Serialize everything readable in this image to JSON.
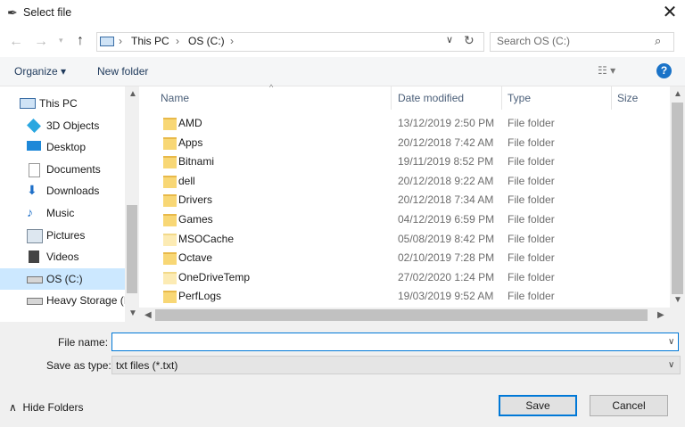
{
  "window": {
    "title": "Select file",
    "close": "✕"
  },
  "address": {
    "segments": [
      "This PC",
      "OS (C:)"
    ],
    "search_placeholder": "Search OS (C:)"
  },
  "toolbar": {
    "organize": "Organize ▾",
    "new_folder": "New folder",
    "help": "?"
  },
  "nav": [
    {
      "label": "This PC",
      "icon": "pc-icon"
    },
    {
      "label": "3D Objects",
      "icon": "cube-icon"
    },
    {
      "label": "Desktop",
      "icon": "desktop-icon"
    },
    {
      "label": "Documents",
      "icon": "document-icon"
    },
    {
      "label": "Downloads",
      "icon": "download-arrow-icon"
    },
    {
      "label": "Music",
      "icon": "music-note-icon"
    },
    {
      "label": "Pictures",
      "icon": "picture-icon"
    },
    {
      "label": "Videos",
      "icon": "film-icon"
    },
    {
      "label": "OS (C:)",
      "icon": "drive-icon",
      "selected": true
    },
    {
      "label": "Heavy Storage (I",
      "icon": "drive-icon"
    }
  ],
  "columns": {
    "name": "Name",
    "date": "Date modified",
    "type": "Type",
    "size": "Size"
  },
  "files": [
    {
      "name": "AMD",
      "date": "13/12/2019 2:50 PM",
      "type": "File folder"
    },
    {
      "name": "Apps",
      "date": "20/12/2018 7:42 AM",
      "type": "File folder"
    },
    {
      "name": "Bitnami",
      "date": "19/11/2019 8:52 PM",
      "type": "File folder"
    },
    {
      "name": "dell",
      "date": "20/12/2018 9:22 AM",
      "type": "File folder"
    },
    {
      "name": "Drivers",
      "date": "20/12/2018 7:34 AM",
      "type": "File folder"
    },
    {
      "name": "Games",
      "date": "04/12/2019 6:59 PM",
      "type": "File folder"
    },
    {
      "name": "MSOCache",
      "date": "05/08/2019 8:42 PM",
      "type": "File folder",
      "light": true
    },
    {
      "name": "Octave",
      "date": "02/10/2019 7:28 PM",
      "type": "File folder"
    },
    {
      "name": "OneDriveTemp",
      "date": "27/02/2020 1:24 PM",
      "type": "File folder",
      "light": true
    },
    {
      "name": "PerfLogs",
      "date": "19/03/2019 9:52 AM",
      "type": "File folder"
    }
  ],
  "form": {
    "file_name_label": "File name:",
    "file_name_value": "",
    "save_as_label": "Save as type:",
    "save_as_value": "txt files (*.txt)"
  },
  "buttons": {
    "hide_folders": "Hide Folders",
    "save": "Save",
    "cancel": "Cancel"
  },
  "colors": {
    "accent": "#0078d7",
    "selection": "#cce8ff",
    "folder": "#f8d775"
  }
}
